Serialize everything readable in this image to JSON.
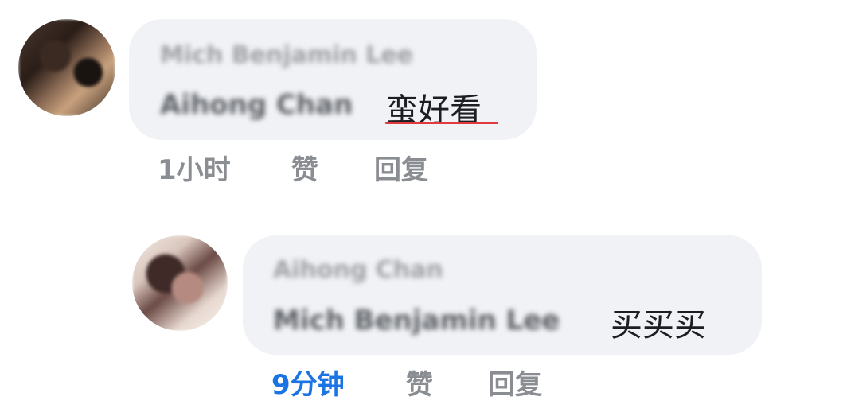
{
  "comments": [
    {
      "author": "Mich Benjamin Lee",
      "mention": "Aihong Chan",
      "text": "蛮好看",
      "time": "1小时",
      "like_label": "赞",
      "reply_label": "回复"
    },
    {
      "author": "Aihong Chan",
      "mention": "Mich Benjamin Lee",
      "text": "买买买",
      "time": "9分钟",
      "like_label": "赞",
      "reply_label": "回复"
    }
  ],
  "colors": {
    "bubble": "#f0f2f5",
    "meta_gray": "#8a8d91",
    "time_blue": "#1b74e4",
    "underline_red": "#e0393e"
  }
}
